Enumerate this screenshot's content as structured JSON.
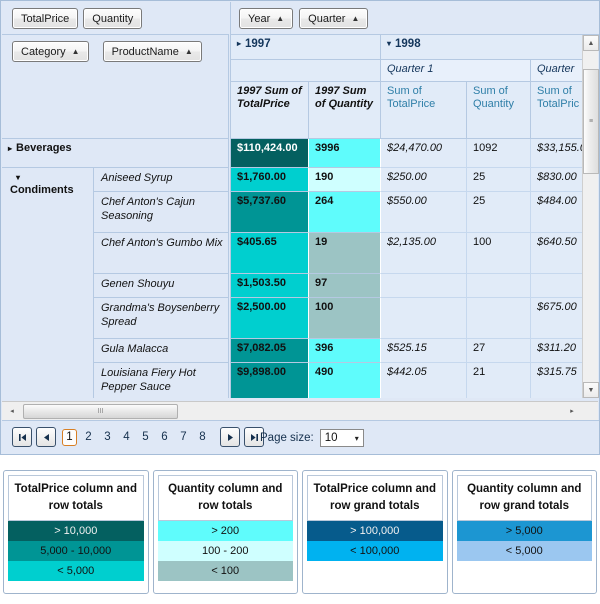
{
  "measures": [
    {
      "label": "TotalPrice"
    },
    {
      "label": "Quantity"
    }
  ],
  "row_fields": [
    {
      "label": "Category",
      "sort": "▲"
    },
    {
      "label": "ProductName",
      "sort": "▲"
    }
  ],
  "column_fields": [
    {
      "label": "Year",
      "sort": "▲"
    },
    {
      "label": "Quarter",
      "sort": "▲"
    }
  ],
  "column_headers": {
    "year_1997": {
      "label": "1997",
      "expander": "▸"
    },
    "year_1998": {
      "label": "1998",
      "expander": "▾"
    },
    "quarter1": "Quarter 1",
    "quarter2": "Quarter",
    "m1997_total_price": "1997 Sum of TotalPrice",
    "m1997_quantity": "1997 Sum of Quantity",
    "m_sum_total_price": "Sum of TotalPrice",
    "m_sum_quantity": "Sum of Quantity",
    "m_sum_total_price_clip": "Sum of TotalPric"
  },
  "row_groups": [
    {
      "category": "Beverages",
      "expander": "▸",
      "collapsed": true,
      "product": "",
      "cells": {
        "p1997": "$110,424.00",
        "q1997": "3996",
        "p98q1": "$24,470.00",
        "q98q1": "1092",
        "p98q2": "$33,155.0"
      }
    },
    {
      "category": "Condiments",
      "expander": "▾",
      "collapsed": false,
      "rows": [
        {
          "product": "Aniseed Syrup",
          "p1997": "$1,760.00",
          "q1997": "190",
          "p98q1": "$250.00",
          "q98q1": "25",
          "p98q2": "$830.00"
        },
        {
          "product": "Chef Anton's Cajun Seasoning",
          "p1997": "$5,737.60",
          "q1997": "264",
          "p98q1": "$550.00",
          "q98q1": "25",
          "p98q2": "$484.00"
        },
        {
          "product": "Chef Anton's Gumbo Mix",
          "p1997": "$405.65",
          "q1997": "19",
          "p98q1": "$2,135.00",
          "q98q1": "100",
          "p98q2": "$640.50"
        },
        {
          "product": "Genen Shouyu",
          "p1997": "$1,503.50",
          "q1997": "97",
          "p98q1": "",
          "q98q1": "",
          "p98q2": ""
        },
        {
          "product": "Grandma's Boysenberry Spread",
          "p1997": "$2,500.00",
          "q1997": "100",
          "p98q1": "",
          "q98q1": "",
          "p98q2": "$675.00"
        },
        {
          "product": "Gula Malacca",
          "p1997": "$7,082.05",
          "q1997": "396",
          "p98q1": "$525.15",
          "q98q1": "27",
          "p98q2": "$311.20"
        },
        {
          "product": "Louisiana Fiery Hot Pepper Sauce",
          "p1997": "$9,898.00",
          "q1997": "490",
          "p98q1": "$442.05",
          "q98q1": "21",
          "p98q2": "$315.75"
        }
      ]
    }
  ],
  "cell_colors": {
    "price_gt10000": "#046060",
    "price_5000_10000": "#009595",
    "price_lt5000": "#00CFCF",
    "qty_gt200": "#5FFCFC",
    "qty_100_200": "#CFFFFF",
    "qty_lt100": "#9CC4C4",
    "price_grand_gt100000": "#065B8C",
    "price_grand_lt100000": "#00B2F0",
    "qty_grand_gt5000": "#1C96D2",
    "qty_grand_lt5000": "#9BC7F0",
    "detail_bg": "#E1EBF8"
  },
  "scroll": {
    "v_up": "▲",
    "v_down": "▼",
    "v_grip": "≡",
    "h_left": "◂",
    "h_right": "▸",
    "h_grip": "III"
  },
  "pager": {
    "first": "⏮",
    "prev": "◀",
    "next": "▶",
    "last": "⏭",
    "pages": [
      "1",
      "2",
      "3",
      "4",
      "5",
      "6",
      "7",
      "8"
    ],
    "active_page": "1",
    "page_size_label": "Page size:",
    "page_size_value": "10",
    "page_size_arrow": "▾"
  },
  "legends": [
    {
      "title": "TotalPrice column and row totals",
      "rows": [
        {
          "label": "> 10,000",
          "color": "#046060",
          "text_color": "#f0f0f0"
        },
        {
          "label": "5,000 - 10,000",
          "color": "#009595",
          "text_color": "#111111"
        },
        {
          "label": "< 5,000",
          "color": "#00CFCF",
          "text_color": "#111111"
        }
      ]
    },
    {
      "title": "Quantity column and row totals",
      "rows": [
        {
          "label": "> 200",
          "color": "#5FFCFC",
          "text_color": "#111111"
        },
        {
          "label": "100 - 200",
          "color": "#CFFFFF",
          "text_color": "#111111"
        },
        {
          "label": "< 100",
          "color": "#9CC4C4",
          "text_color": "#111111"
        }
      ]
    },
    {
      "title": "TotalPrice column and row grand totals",
      "rows": [
        {
          "label": "> 100,000",
          "color": "#065B8C",
          "text_color": "#f0f0f0"
        },
        {
          "label": "< 100,000",
          "color": "#00B2F0",
          "text_color": "#111111"
        }
      ]
    },
    {
      "title": "Quantity column and row grand totals",
      "rows": [
        {
          "label": "> 5,000",
          "color": "#1C96D2",
          "text_color": "#111111"
        },
        {
          "label": "< 5,000",
          "color": "#9BC7F0",
          "text_color": "#111111"
        }
      ]
    }
  ]
}
